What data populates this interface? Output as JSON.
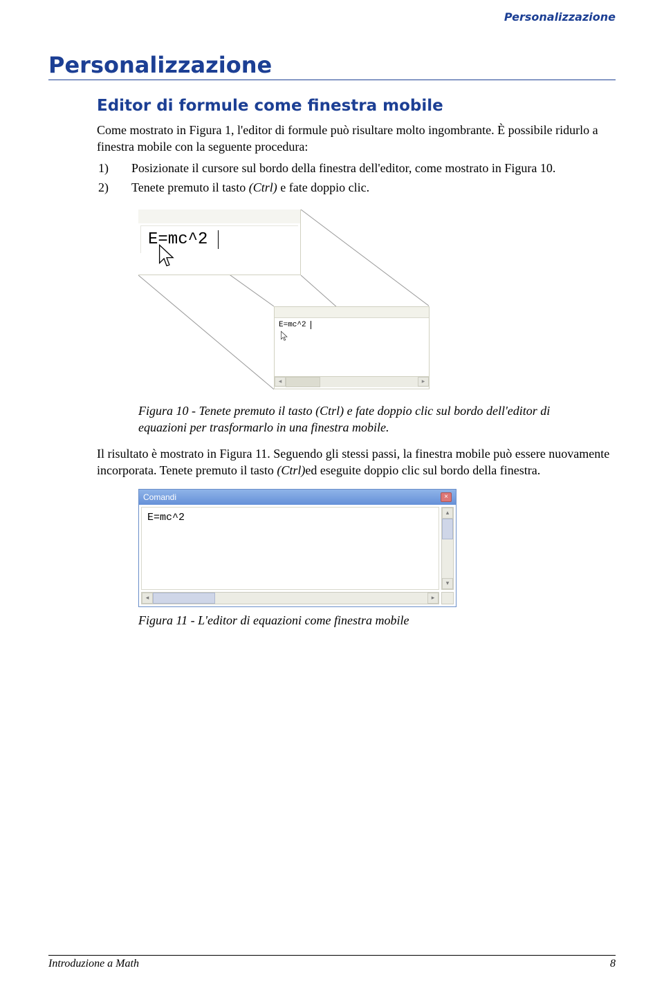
{
  "header_right": "Personalizzazione",
  "main_title": "Personalizzazione",
  "section": {
    "sub_title": "Editor di formule come finestra mobile",
    "intro": "Come mostrato in Figura 1, l'editor di formule può risultare molto ingombrante. È possibile ridurlo a finestra mobile con la seguente procedura:",
    "step1_num": "1)",
    "step1_text": "Posizionate il cursore sul bordo della finestra dell'editor, come mostrato in Figura 10.",
    "step2_num": "2)",
    "step2_a": "Tenete premuto il tasto ",
    "step2_ctrl": "(Ctrl)",
    "step2_b": " e fate doppio clic."
  },
  "fig10": {
    "formula_large": "E=mc^2",
    "formula_small": "E=mc^2",
    "caption": "Figura 10 - Tenete premuto il tasto (Ctrl) e fate doppio clic sul bordo dell'editor di equazioni per trasformarlo in una finestra mobile."
  },
  "para2_a": "Il risultato è mostrato in Figura 11. Seguendo gli stessi passi, la finestra mobile può essere nuovamente incorporata. Tenete premuto il tasto ",
  "para2_ctrl": "(Ctrl)",
  "para2_b": "ed eseguite doppio clic sul bordo della finestra.",
  "fig11": {
    "title": "Comandi",
    "formula": "E=mc^2",
    "caption": "Figura 11 - L'editor di equazioni come finestra mobile"
  },
  "footer": {
    "left": "Introduzione a Math",
    "right": "8"
  }
}
